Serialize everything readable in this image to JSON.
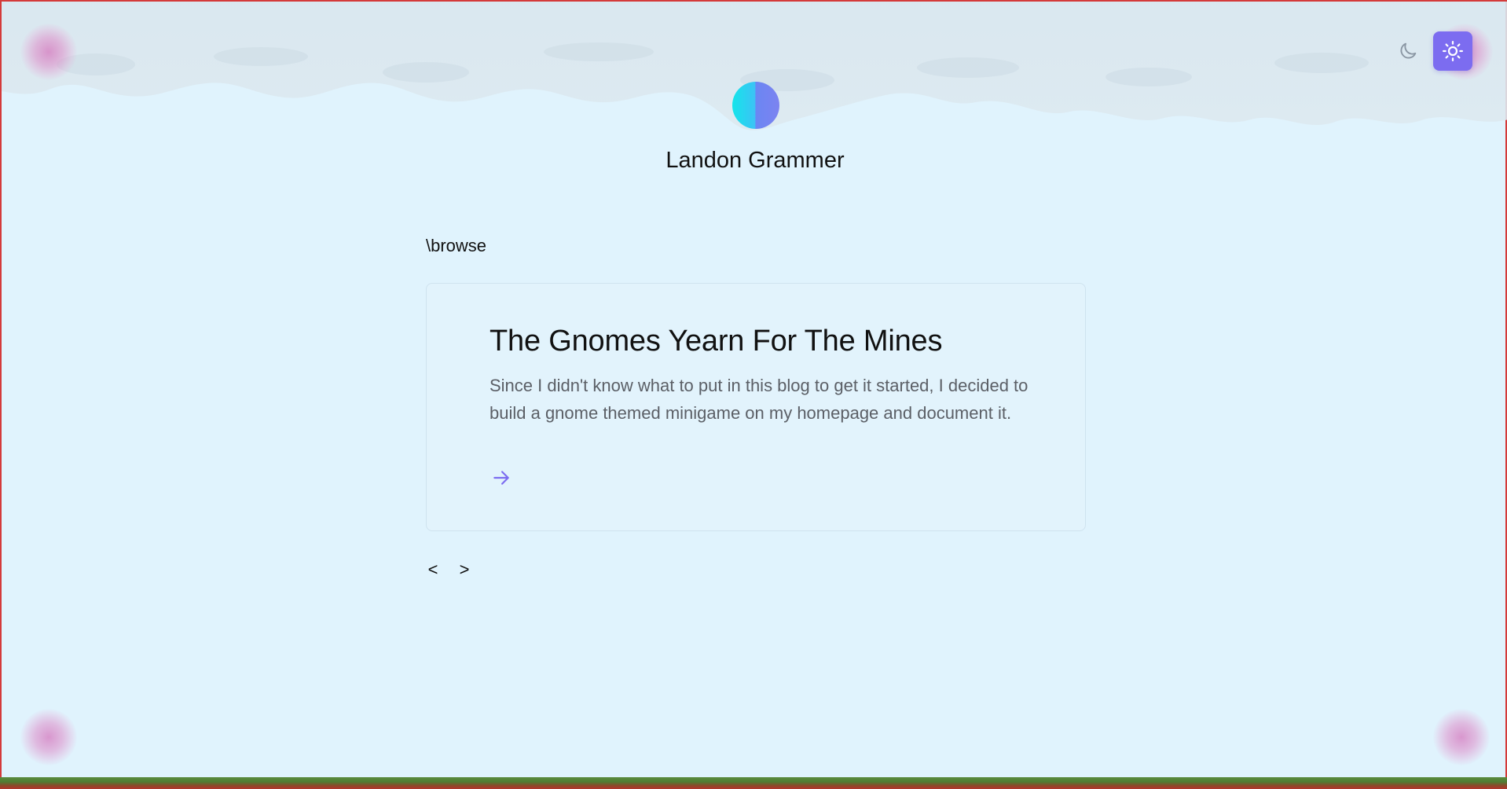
{
  "header": {
    "site_name": "Landon Grammer"
  },
  "theme": {
    "accent": "#7c6cf0",
    "options": [
      "moon-icon",
      "sun-icon"
    ],
    "active": "light"
  },
  "breadcrumb": "\\browse",
  "posts": [
    {
      "title": "The Gnomes Yearn For The Mines",
      "excerpt": "Since I didn't know what to put in this blog to get it started, I decided to build a gnome themed minigame on my homepage and document it.",
      "link_icon": "arrow-right-icon"
    }
  ],
  "pager": {
    "prev": "<",
    "next": ">"
  }
}
